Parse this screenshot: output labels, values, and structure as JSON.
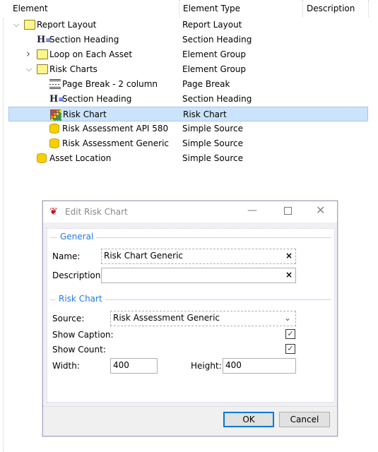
{
  "tree": {
    "columns": [
      "Element",
      "Element Type",
      "Description"
    ],
    "rows": [
      {
        "label": "Report Layout",
        "type": "Report Layout",
        "icon": "folder-open-icon",
        "level": 0,
        "expander": "expanded"
      },
      {
        "label": "Section Heading",
        "type": "Section Heading",
        "icon": "heading-icon",
        "level": 1
      },
      {
        "label": "Loop on Each Asset",
        "type": "Element Group",
        "icon": "folder-icon",
        "level": 1,
        "expander": "collapsed"
      },
      {
        "label": "Risk Charts",
        "type": "Element Group",
        "icon": "folder-open-icon",
        "level": 1,
        "expander": "expanded"
      },
      {
        "label": "Page Break - 2 column",
        "type": "Page Break",
        "icon": "page-break-icon",
        "level": 2
      },
      {
        "label": "Section Heading",
        "type": "Section Heading",
        "icon": "heading-icon",
        "level": 2
      },
      {
        "label": "Risk Chart",
        "type": "Risk Chart",
        "icon": "risk-matrix-icon",
        "level": 2,
        "selected": true
      },
      {
        "label": "Risk Assessment API 580",
        "type": "Simple Source",
        "icon": "database-icon",
        "level": 2
      },
      {
        "label": "Risk Assessment Generic",
        "type": "Simple Source",
        "icon": "database-icon",
        "level": 2
      },
      {
        "label": "Asset Location",
        "type": "Simple Source",
        "icon": "database-icon",
        "level": 1
      }
    ]
  },
  "dialog": {
    "title": "Edit Risk Chart",
    "general_group": "General",
    "name_label": "Name:",
    "name_value": "Risk Chart Generic",
    "description_label": "Description:",
    "description_value": "",
    "clear_glyph": "×",
    "risk_group": "Risk Chart",
    "source_label": "Source:",
    "source_value": "Risk Assessment Generic",
    "show_caption_label": "Show Caption:",
    "show_caption": true,
    "show_count_label": "Show Count:",
    "show_count": true,
    "width_label": "Width:",
    "width_value": "400",
    "height_label": "Height:",
    "height_value": "400",
    "ok_label": "OK",
    "cancel_label": "Cancel"
  },
  "colors": {
    "selection": "#cce4fb",
    "group_header": "#1e7be8",
    "default_button": "#0078d7"
  }
}
